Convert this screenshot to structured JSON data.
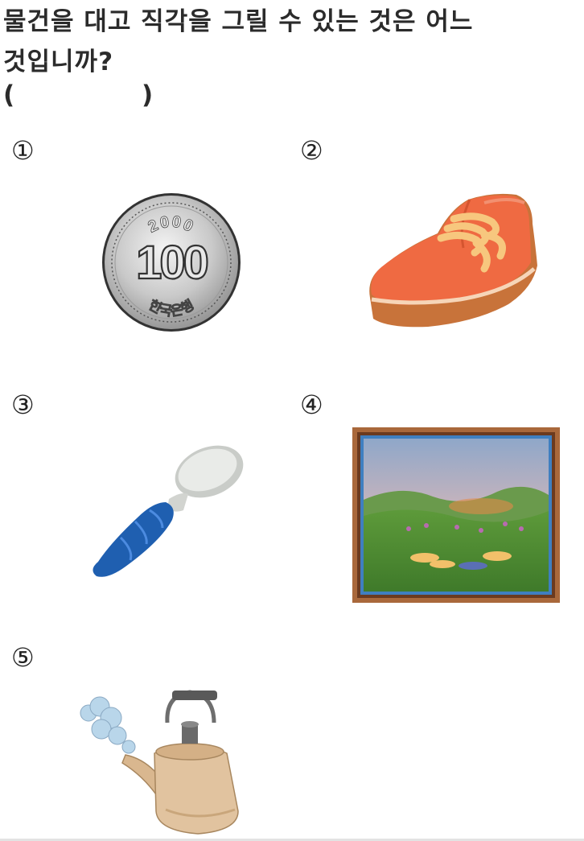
{
  "question": {
    "line1": "물건을 대고 직각을 그릴 수 있는 것은 어느",
    "line2": "것입니까?"
  },
  "answer_blank": {
    "open": "(",
    "close": ")"
  },
  "options": [
    {
      "number": "①",
      "icon": "coin-icon",
      "coin_year": "2000",
      "coin_value": "100",
      "coin_country": "한국은행"
    },
    {
      "number": "②",
      "icon": "shoe-icon"
    },
    {
      "number": "③",
      "icon": "spoon-icon"
    },
    {
      "number": "④",
      "icon": "picture-frame-icon"
    },
    {
      "number": "⑤",
      "icon": "kettle-icon"
    }
  ]
}
